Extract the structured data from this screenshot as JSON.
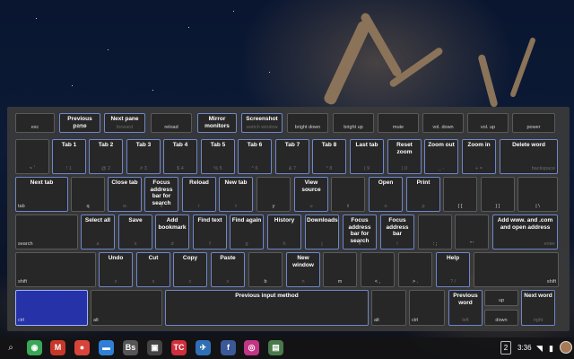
{
  "keyboard_overlay": {
    "row1": [
      {
        "name": "key-esc",
        "shortcut": "",
        "cap": "esc",
        "hl": false
      },
      {
        "name": "key-back",
        "shortcut": "Previous pane",
        "cap": "back",
        "hl": true
      },
      {
        "name": "key-forward",
        "shortcut": "Next pane",
        "cap": "forward",
        "hl": true
      },
      {
        "name": "key-reload",
        "shortcut": "",
        "cap": "reload",
        "hl": false
      },
      {
        "name": "key-full-screen",
        "shortcut": "Mirror monitors",
        "cap": "",
        "hl": true
      },
      {
        "name": "key-switch-window",
        "shortcut": "Screenshot",
        "cap": "switch window",
        "hl": true
      },
      {
        "name": "key-bright-down",
        "shortcut": "",
        "cap": "bright down",
        "hl": false
      },
      {
        "name": "key-bright-up",
        "shortcut": "",
        "cap": "bright up",
        "hl": false
      },
      {
        "name": "key-mute",
        "shortcut": "",
        "cap": "mute",
        "hl": false
      },
      {
        "name": "key-vol-down",
        "shortcut": "",
        "cap": "vol. down",
        "hl": false
      },
      {
        "name": "key-vol-up",
        "shortcut": "",
        "cap": "vol. up",
        "hl": false
      },
      {
        "name": "key-power",
        "shortcut": "",
        "cap": "power",
        "hl": false
      }
    ],
    "row2": [
      {
        "name": "key-backtick",
        "shortcut": "",
        "cap": "~ `",
        "hl": false
      },
      {
        "name": "key-1",
        "shortcut": "Tab 1",
        "cap": "! 1",
        "hl": true
      },
      {
        "name": "key-2",
        "shortcut": "Tab 2",
        "cap": "@ 2",
        "hl": true
      },
      {
        "name": "key-3",
        "shortcut": "Tab 3",
        "cap": "# 3",
        "hl": true
      },
      {
        "name": "key-4",
        "shortcut": "Tab 4",
        "cap": "$ 4",
        "hl": true
      },
      {
        "name": "key-5",
        "shortcut": "Tab 5",
        "cap": "% 5",
        "hl": true
      },
      {
        "name": "key-6",
        "shortcut": "Tab 6",
        "cap": "^ 6",
        "hl": true
      },
      {
        "name": "key-7",
        "shortcut": "Tab 7",
        "cap": "& 7",
        "hl": true
      },
      {
        "name": "key-8",
        "shortcut": "Tab 8",
        "cap": "* 8",
        "hl": true
      },
      {
        "name": "key-9",
        "shortcut": "Last tab",
        "cap": "( 9",
        "hl": true
      },
      {
        "name": "key-0",
        "shortcut": "Reset zoom",
        "cap": ") 0",
        "hl": true
      },
      {
        "name": "key-minus",
        "shortcut": "Zoom out",
        "cap": "_ -",
        "hl": true
      },
      {
        "name": "key-equals",
        "shortcut": "Zoom in",
        "cap": "+ =",
        "hl": true
      },
      {
        "name": "key-backspace",
        "shortcut": "Delete word",
        "cap": "backspace",
        "hl": true
      }
    ],
    "row3": [
      {
        "name": "key-tab",
        "shortcut": "Next tab",
        "cap": "tab",
        "hl": true
      },
      {
        "name": "key-q",
        "shortcut": "",
        "cap": "q",
        "hl": false
      },
      {
        "name": "key-w",
        "shortcut": "Close tab",
        "cap": "w",
        "hl": true
      },
      {
        "name": "key-e",
        "shortcut": "Focus address bar for search",
        "cap": "e",
        "hl": true
      },
      {
        "name": "key-r",
        "shortcut": "Reload",
        "cap": "r",
        "hl": true
      },
      {
        "name": "key-t",
        "shortcut": "New tab",
        "cap": "t",
        "hl": true
      },
      {
        "name": "key-y",
        "shortcut": "",
        "cap": "y",
        "hl": false
      },
      {
        "name": "key-u",
        "shortcut": "View source",
        "cap": "u",
        "hl": true
      },
      {
        "name": "key-i",
        "shortcut": "",
        "cap": "i",
        "hl": false
      },
      {
        "name": "key-o",
        "shortcut": "Open",
        "cap": "o",
        "hl": true
      },
      {
        "name": "key-p",
        "shortcut": "Print",
        "cap": "p",
        "hl": true
      },
      {
        "name": "key-lbracket",
        "shortcut": "",
        "cap": "{ [",
        "hl": false
      },
      {
        "name": "key-rbracket",
        "shortcut": "",
        "cap": "} ]",
        "hl": false
      },
      {
        "name": "key-backslash",
        "shortcut": "",
        "cap": "| \\",
        "hl": false
      }
    ],
    "row4": [
      {
        "name": "key-search",
        "shortcut": "",
        "cap": "search",
        "hl": false
      },
      {
        "name": "key-a",
        "shortcut": "Select all",
        "cap": "a",
        "hl": true
      },
      {
        "name": "key-s",
        "shortcut": "Save",
        "cap": "s",
        "hl": true
      },
      {
        "name": "key-d",
        "shortcut": "Add bookmark",
        "cap": "d",
        "hl": true
      },
      {
        "name": "key-f",
        "shortcut": "Find text",
        "cap": "f",
        "hl": true
      },
      {
        "name": "key-g",
        "shortcut": "Find again",
        "cap": "g",
        "hl": true
      },
      {
        "name": "key-h",
        "shortcut": "History",
        "cap": "h",
        "hl": true
      },
      {
        "name": "key-j",
        "shortcut": "Downloads",
        "cap": "j",
        "hl": true
      },
      {
        "name": "key-k",
        "shortcut": "Focus address bar for search",
        "cap": "k",
        "hl": true
      },
      {
        "name": "key-l",
        "shortcut": "Focus address bar",
        "cap": "l",
        "hl": true
      },
      {
        "name": "key-semicolon",
        "shortcut": "",
        "cap": ": ;",
        "hl": false
      },
      {
        "name": "key-quote",
        "shortcut": "",
        "cap": "\" '",
        "hl": false
      },
      {
        "name": "key-enter",
        "shortcut": "Add www. and .com and open address",
        "cap": "enter",
        "hl": true
      }
    ],
    "row5": [
      {
        "name": "key-shift-left",
        "shortcut": "",
        "cap": "shift",
        "hl": false
      },
      {
        "name": "key-z",
        "shortcut": "Undo",
        "cap": "z",
        "hl": true
      },
      {
        "name": "key-x",
        "shortcut": "Cut",
        "cap": "x",
        "hl": true
      },
      {
        "name": "key-c",
        "shortcut": "Copy",
        "cap": "c",
        "hl": true
      },
      {
        "name": "key-v",
        "shortcut": "Paste",
        "cap": "v",
        "hl": true
      },
      {
        "name": "key-b",
        "shortcut": "",
        "cap": "b",
        "hl": false
      },
      {
        "name": "key-n",
        "shortcut": "New window",
        "cap": "n",
        "hl": true
      },
      {
        "name": "key-m",
        "shortcut": "",
        "cap": "m",
        "hl": false
      },
      {
        "name": "key-comma",
        "shortcut": "",
        "cap": "< ,",
        "hl": false
      },
      {
        "name": "key-period",
        "shortcut": "",
        "cap": "> .",
        "hl": false
      },
      {
        "name": "key-slash",
        "shortcut": "Help",
        "cap": "? /",
        "hl": true
      },
      {
        "name": "key-shift-right",
        "shortcut": "",
        "cap": "shift",
        "hl": false
      }
    ],
    "row6": [
      {
        "name": "key-ctrl-left",
        "shortcut": "",
        "cap": "ctrl",
        "hl": false,
        "active": true
      },
      {
        "name": "key-alt-left",
        "shortcut": "",
        "cap": "alt",
        "hl": false
      },
      {
        "name": "key-space",
        "shortcut": "Previous input method",
        "cap": "",
        "hl": true
      },
      {
        "name": "key-alt-right",
        "shortcut": "",
        "cap": "alt",
        "hl": false
      },
      {
        "name": "key-ctrl-right",
        "shortcut": "",
        "cap": "ctrl",
        "hl": false
      },
      {
        "name": "key-left",
        "shortcut": "Previous word",
        "cap": "left",
        "hl": true
      },
      {
        "name": "key-up",
        "shortcut": "",
        "cap": "up",
        "hl": false
      },
      {
        "name": "key-down",
        "shortcut": "",
        "cap": "down",
        "hl": false
      },
      {
        "name": "key-right",
        "shortcut": "Next word",
        "cap": "right",
        "hl": true
      }
    ]
  },
  "shelf": {
    "apps": [
      {
        "name": "chrome-app-icon",
        "glyph": "◉",
        "color": "#3aa757"
      },
      {
        "name": "gmail-app-icon",
        "glyph": "M",
        "color": "#c5382a"
      },
      {
        "name": "app-icon-3",
        "glyph": "●",
        "color": "#d8443a"
      },
      {
        "name": "files-app-icon",
        "glyph": "▬",
        "color": "#2f7fd6"
      },
      {
        "name": "app-icon-5",
        "glyph": "Bs",
        "color": "#555555"
      },
      {
        "name": "app-icon-6",
        "glyph": "▣",
        "color": "#444444"
      },
      {
        "name": "app-icon-7",
        "glyph": "TC",
        "color": "#cf2f3a"
      },
      {
        "name": "app-icon-8",
        "glyph": "✈",
        "color": "#2f6fb5"
      },
      {
        "name": "facebook-app-icon",
        "glyph": "f",
        "color": "#3b5998"
      },
      {
        "name": "instagram-app-icon",
        "glyph": "◎",
        "color": "#c13584"
      },
      {
        "name": "app-icon-11",
        "glyph": "▤",
        "color": "#4a7a4a"
      }
    ],
    "notification_count": "2",
    "clock": "3:36"
  }
}
